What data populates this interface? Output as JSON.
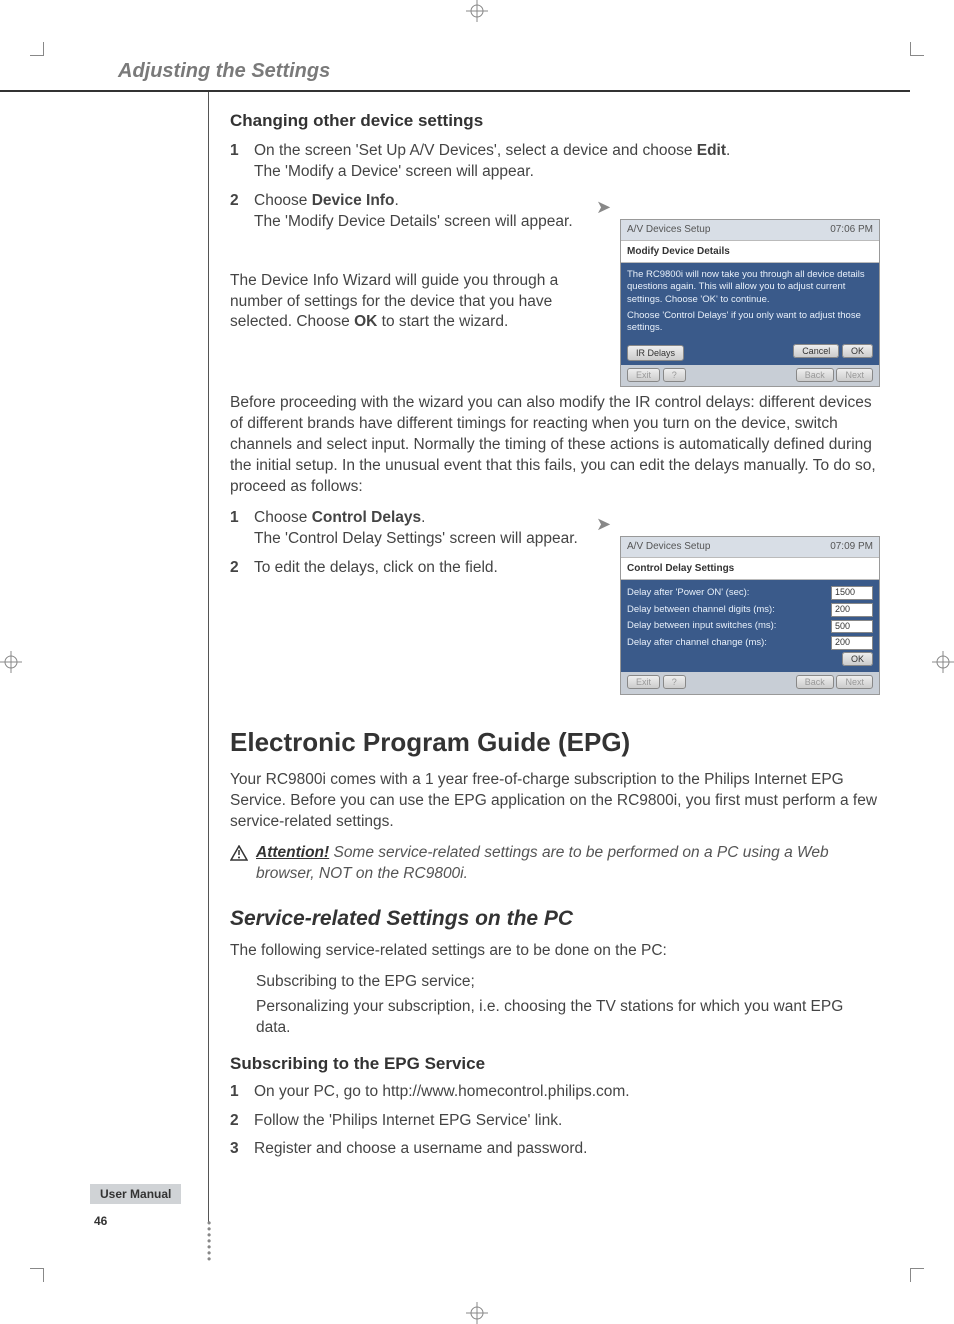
{
  "header": {
    "section_title": "Adjusting the Settings"
  },
  "sec_a": {
    "heading": "Changing other device settings",
    "step1_num": "1",
    "step1_a": "On the screen 'Set Up A/V Devices', select a device and choose ",
    "step1_bold": "Edit",
    "step1_b": ".",
    "step1_line2": "The 'Modify a Device' screen will appear.",
    "step2_num": "2",
    "step2_a": "Choose ",
    "step2_bold": "Device Info",
    "step2_b": ".",
    "step2_line2": "The 'Modify Device Details' screen will appear.",
    "wizard_a": "The Device Info Wizard will guide you through a number of settings for the device that you have selected. Choose ",
    "wizard_bold": "OK",
    "wizard_b": " to start the wizard.",
    "before": "Before proceeding with the wizard you can also modify the IR control delays: different devices of different brands have different timings for reacting when you turn on the device, switch channels and select input. Normally the timing of these actions is automatically defined during the initial setup. In the unusual event that this fails, you can edit the delays manually. To do so, proceed as follows:",
    "cd_step1_num": "1",
    "cd_step1_a": "Choose ",
    "cd_step1_bold": "Control Delays",
    "cd_step1_b": ".",
    "cd_step1_line2": "The 'Control Delay Settings' screen will appear.",
    "cd_step2_num": "2",
    "cd_step2": "To edit the delays, click on the field."
  },
  "shot1": {
    "title": "A/V Devices Setup",
    "time": "07:06 PM",
    "sub": "Modify Device Details",
    "body1": "The RC9800i will now take you through all device details questions again. This will allow you to adjust current settings. Choose 'OK' to continue.",
    "body2": "Choose 'Control Delays' if you only want to adjust those settings.",
    "btn_ir": "IR Delays",
    "btn_cancel": "Cancel",
    "btn_ok": "OK",
    "btn_exit": "Exit",
    "btn_q": "?",
    "btn_back": "Back",
    "btn_next": "Next"
  },
  "shot2": {
    "title": "A/V Devices Setup",
    "time": "07:09 PM",
    "sub": "Control Delay Settings",
    "row1_l": "Delay after 'Power ON' (sec):",
    "row1_v": "1500",
    "row2_l": "Delay between channel digits (ms):",
    "row2_v": "200",
    "row3_l": "Delay between input switches (ms):",
    "row3_v": "500",
    "row4_l": "Delay after channel change (ms):",
    "row4_v": "200",
    "btn_ok": "OK",
    "btn_exit": "Exit",
    "btn_q": "?",
    "btn_back": "Back",
    "btn_next": "Next"
  },
  "epg": {
    "heading": "Electronic Program Guide (EPG)",
    "intro": "Your RC9800i comes with a 1 year free-of-charge subscription to the Philips Internet EPG Service. Before you can use the EPG application on the RC9800i, you first must perform a few service-related settings.",
    "attn_label": "Attention!",
    "attn_text": " Some service-related settings are to be performed on a PC using a Web browser, NOT on the RC9800i.",
    "srv_heading": "Service-related Settings on the PC",
    "srv_intro": "The following service-related settings are to be done on the PC:",
    "bullet1": "Subscribing to the EPG service;",
    "bullet2": "Personalizing your subscription, i.e. choosing the TV stations for which you want EPG data.",
    "sub_heading": "Subscribing to the EPG Service",
    "s1_num": "1",
    "s1": "On your PC, go to http://www.homecontrol.philips.com.",
    "s2_num": "2",
    "s2": "Follow the 'Philips Internet EPG Service' link.",
    "s3_num": "3",
    "s3": "Register and choose a username and password."
  },
  "footer": {
    "label": "User Manual",
    "page": "46"
  }
}
